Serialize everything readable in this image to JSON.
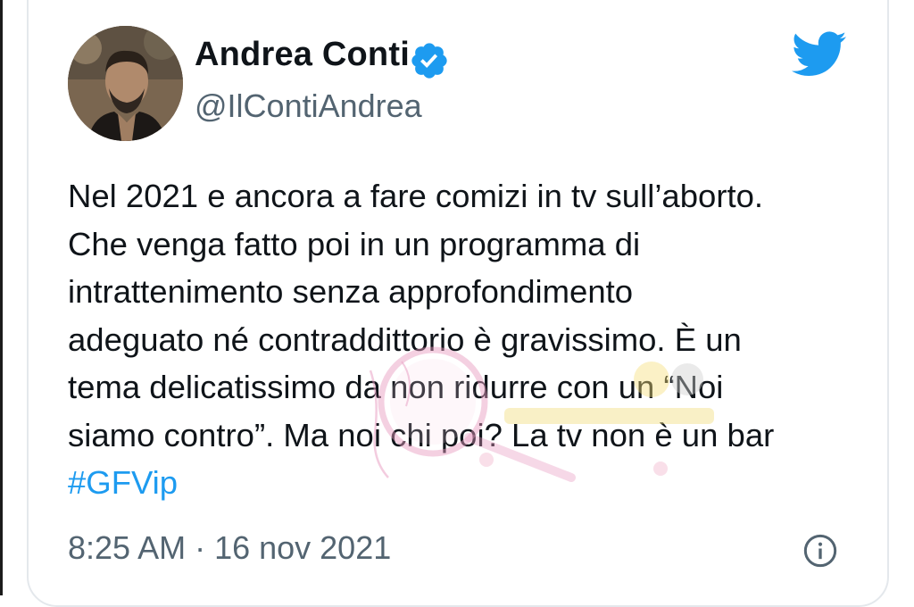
{
  "tweet": {
    "display_name": "Andrea Conti",
    "handle": "@IlContiAndrea",
    "verified": true,
    "text_lines": [
      "Nel 2021 e ancora a fare comizi in tv sull’aborto.",
      "Che venga fatto poi in un programma di",
      "intrattenimento senza approfondimento",
      "adeguato né contraddittorio è gravissimo. È un",
      "tema delicatissimo da non ridurre con un “Noi",
      "siamo contro”. Ma noi chi poi? La tv non è un bar"
    ],
    "hashtag": "#GFVip",
    "timestamp": "8:25 AM · 16 nov 2021"
  },
  "icons": {
    "avatar": "avatar-photo",
    "verified": "verified-badge-icon",
    "brand": "twitter-bird-icon",
    "info": "info-icon"
  },
  "colors": {
    "text_primary": "#0f1419",
    "text_secondary": "#536471",
    "link": "#1d9bf0",
    "card_border": "#e4e8ec",
    "twitter_blue": "#1d9bf0"
  }
}
